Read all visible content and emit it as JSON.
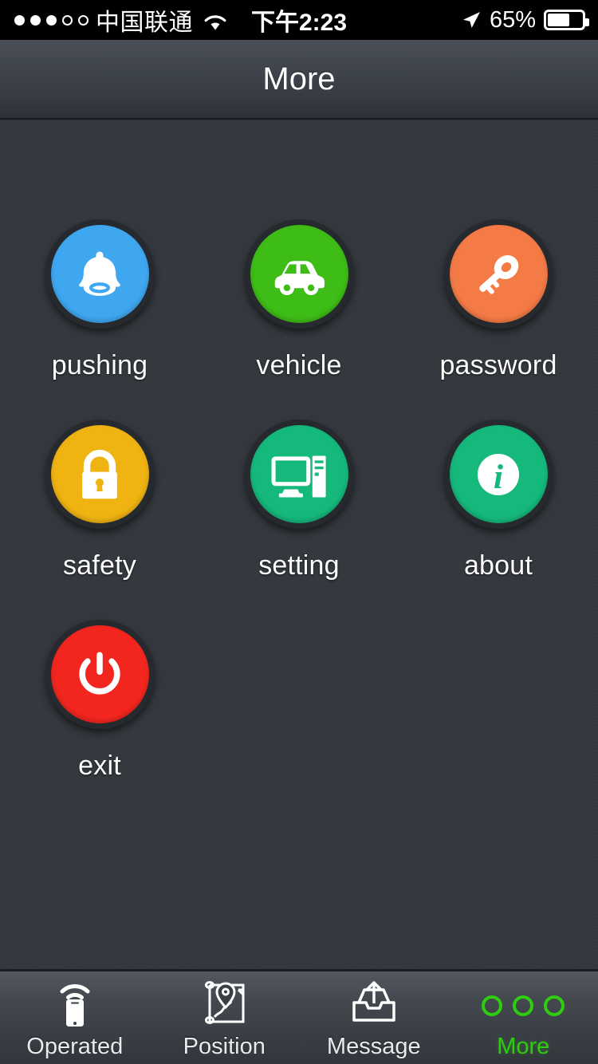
{
  "status_bar": {
    "signal_dots_filled": 3,
    "signal_dots_total": 5,
    "carrier": "中国联通",
    "wifi_icon": "wifi-icon",
    "time": "下午2:23",
    "location_icon": "location-arrow-icon",
    "battery_percent": "65%",
    "battery_level": 65
  },
  "header": {
    "title": "More"
  },
  "grid": {
    "items": [
      {
        "id": "pushing",
        "label": "pushing",
        "icon": "bell-icon",
        "color": "#3fa7f0"
      },
      {
        "id": "vehicle",
        "label": "vehicle",
        "icon": "car-icon",
        "color": "#3ebd16"
      },
      {
        "id": "password",
        "label": "password",
        "icon": "key-icon",
        "color": "#f57b46"
      },
      {
        "id": "safety",
        "label": "safety",
        "icon": "lock-icon",
        "color": "#efb312"
      },
      {
        "id": "setting",
        "label": "setting",
        "icon": "computer-icon",
        "color": "#15b97c"
      },
      {
        "id": "about",
        "label": "about",
        "icon": "info-icon",
        "color": "#15b97c"
      },
      {
        "id": "exit",
        "label": "exit",
        "icon": "power-icon",
        "color": "#f3261f"
      }
    ],
    "ring_color": "#26292e"
  },
  "tabbar": {
    "active_color": "#2fcc10",
    "inactive_color": "#e9eaec",
    "tabs": [
      {
        "id": "operated",
        "label": "Operated",
        "icon": "phone-signal-icon",
        "active": false
      },
      {
        "id": "position",
        "label": "Position",
        "icon": "map-pin-icon",
        "active": false
      },
      {
        "id": "message",
        "label": "Message",
        "icon": "outbox-upload-icon",
        "active": false
      },
      {
        "id": "more",
        "label": "More",
        "icon": "three-circles-icon",
        "active": true
      }
    ]
  }
}
